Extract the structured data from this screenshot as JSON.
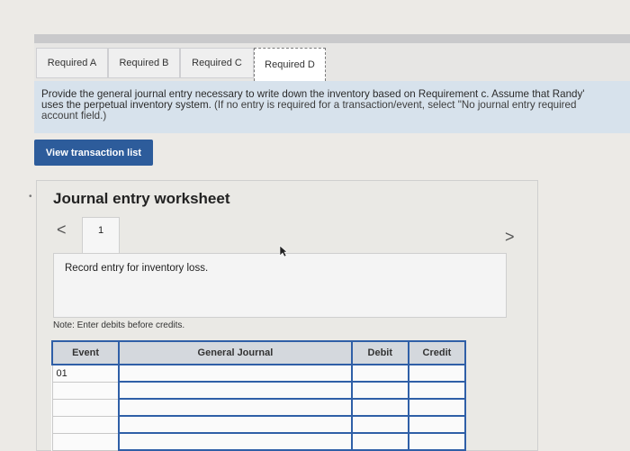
{
  "tabs": [
    "Required A",
    "Required B",
    "Required C",
    "Required D"
  ],
  "active_tab": "Required D",
  "instructions": {
    "line1": "Provide the general journal entry necessary to write down the inventory based on Requirement c. Assume that Randy'",
    "line2a": "uses the perpetual inventory system.",
    "line2b": " (If no entry is required for a transaction/event, select \"No journal entry required",
    "line3": "account field.)"
  },
  "view_button": "View transaction list",
  "worksheet": {
    "title": "Journal entry worksheet",
    "nav_prev": "<",
    "nav_next": ">",
    "entry_tab": "1",
    "record_text": "Record entry for inventory loss.",
    "note": "Note: Enter debits before credits."
  },
  "table": {
    "headers": [
      "Event",
      "General Journal",
      "Debit",
      "Credit"
    ],
    "rows": [
      [
        "01",
        "",
        "",
        ""
      ],
      [
        "",
        "",
        "",
        ""
      ],
      [
        "",
        "",
        "",
        ""
      ],
      [
        "",
        "",
        "",
        ""
      ],
      [
        "",
        "",
        "",
        ""
      ]
    ]
  }
}
